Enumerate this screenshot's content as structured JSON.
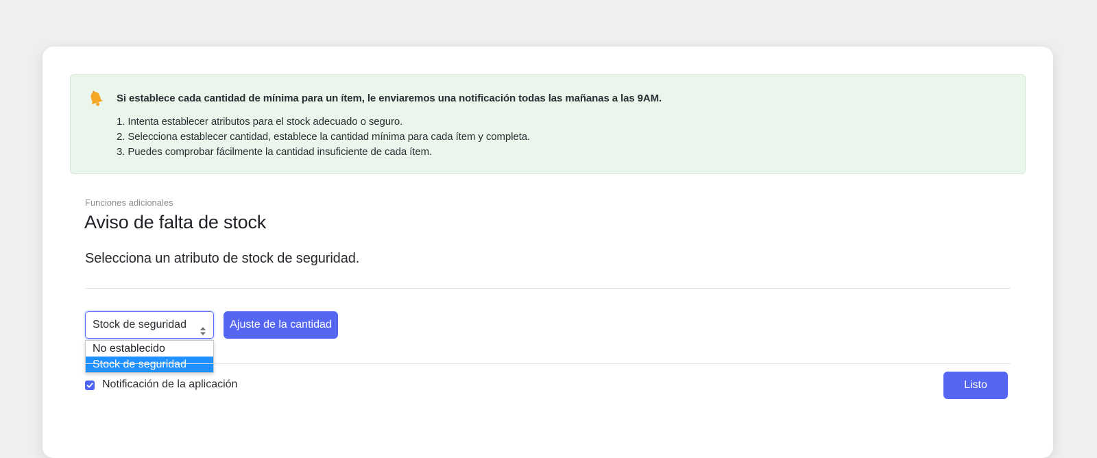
{
  "notice": {
    "icon": "bell-icon",
    "title": "Si establece cada cantidad de mínima para un ítem, le enviaremos una notificación todas las mañanas a las 9AM.",
    "steps": [
      "1. Intenta establecer atributos para el stock adecuado o seguro.",
      "2. Selecciona establecer cantidad, establece la cantidad mínima para cada ítem y completa.",
      "3. Puedes comprobar fácilmente la cantidad insuficiente de cada ítem."
    ]
  },
  "header": {
    "eyebrow": "Funciones adicionales",
    "title": "Aviso de falta de stock",
    "subtitle": "Selecciona un atributo de stock de seguridad."
  },
  "attribute_select": {
    "value": "Stock de seguridad",
    "options": [
      "No establecido",
      "Stock de seguridad"
    ],
    "selected_index": 1
  },
  "buttons": {
    "adjust_label": "Ajuste de la cantidad",
    "done_label": "Listo"
  },
  "app_notification": {
    "label": "Notificación de la aplicación",
    "checked": true
  },
  "colors": {
    "accent": "#5566f2",
    "notice_bg": "#eaf5ec",
    "bell": "#f5a623",
    "option_highlight": "#1e90ff"
  }
}
